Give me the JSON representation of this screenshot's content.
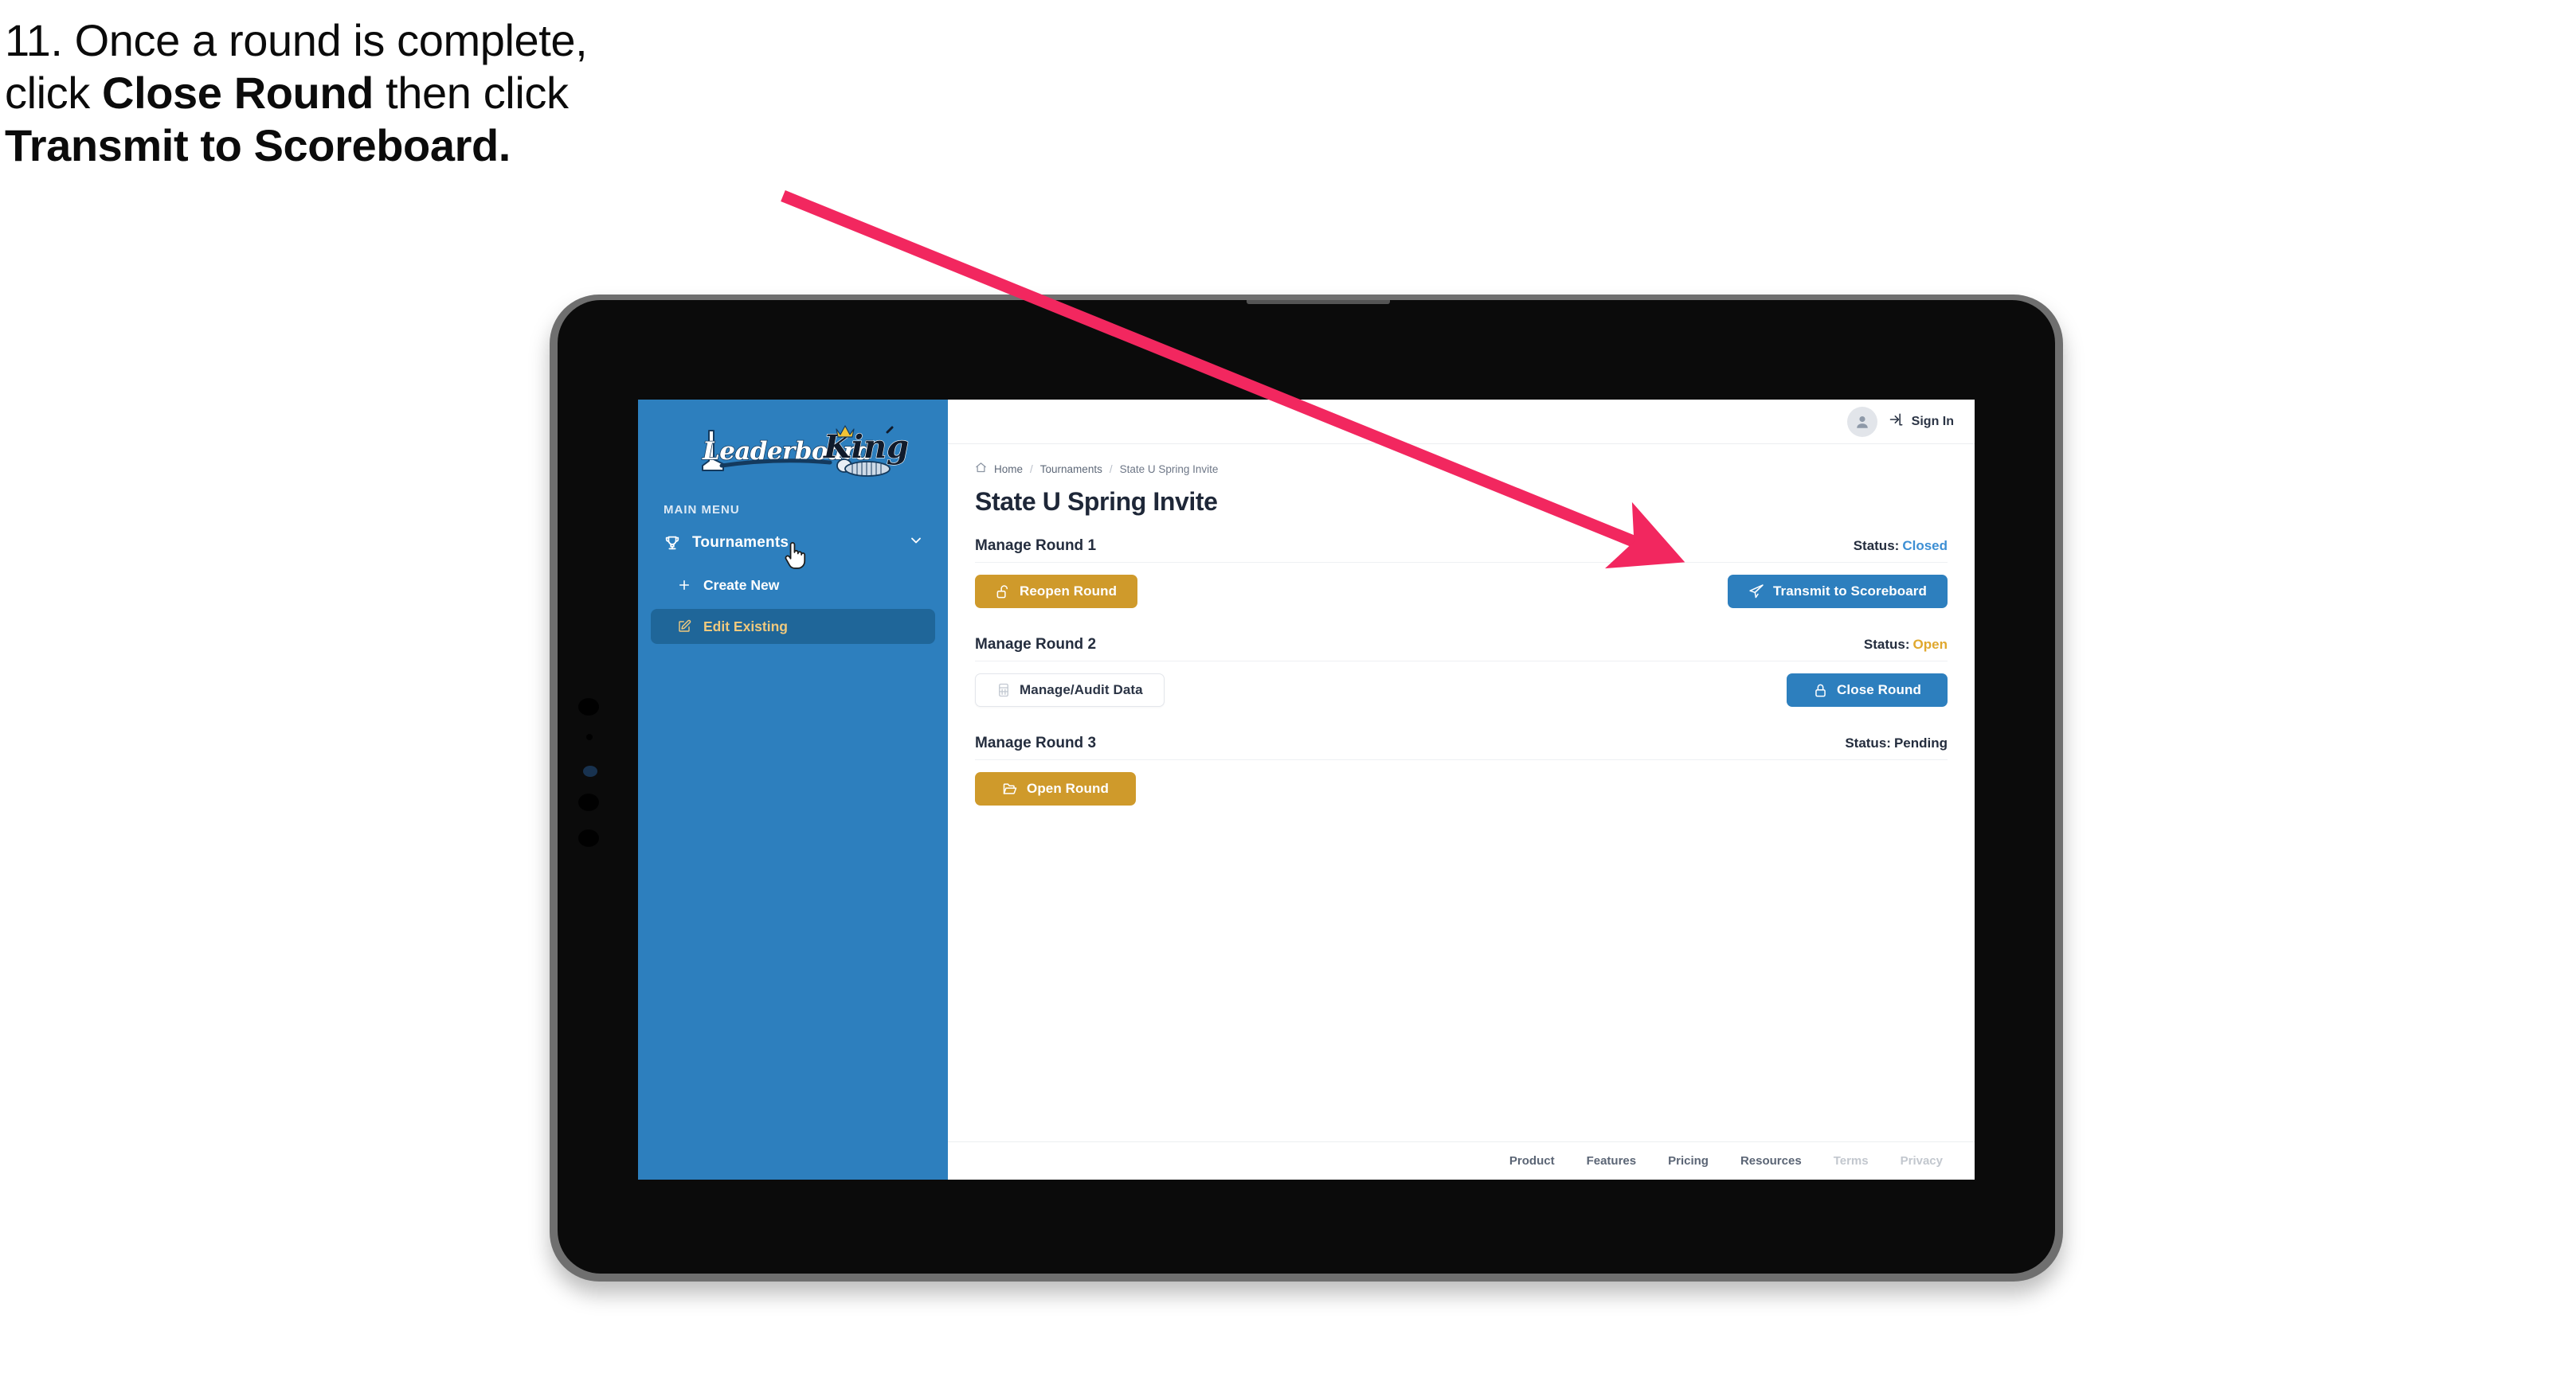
{
  "caption": {
    "line1": "11. Once a round is complete,",
    "line2_pre": "click ",
    "line2_bold": "Close Round",
    "line2_post": " then click",
    "line3_bold": "Transmit to Scoreboard."
  },
  "annotation": {
    "arrow_color": "#f2275f"
  },
  "app": {
    "sidebar": {
      "logo_text": "LeaderboardKing",
      "logo_word1": "Leaderboard",
      "logo_word2": "King",
      "section_label": "MAIN MENU",
      "items": [
        {
          "label": "Tournaments",
          "icon": "trophy-icon",
          "chevron": "chevron-down-icon",
          "active": false
        },
        {
          "label": "Create New",
          "icon": "plus-icon",
          "active": false
        },
        {
          "label": "Edit Existing",
          "icon": "edit-pencil-icon",
          "active": true
        }
      ],
      "bg_color": "#2d7fbe",
      "active_bg_color": "#1f6699",
      "active_text_color": "#efc97e"
    },
    "topbar": {
      "avatar_icon": "user-avatar-icon",
      "signin_icon": "sign-in-arrow-icon",
      "signin_label": "Sign In"
    },
    "breadcrumb": {
      "home_icon": "home-icon",
      "items": [
        "Home",
        "Tournaments",
        "State U Spring Invite"
      ],
      "separator": "/"
    },
    "page_title": "State U Spring Invite",
    "rounds": [
      {
        "title": "Manage Round 1",
        "status_label": "Status:",
        "status_value": "Closed",
        "status_class": "status-closed",
        "left_button": {
          "label": "Reopen Round",
          "icon": "unlock-icon",
          "style": "gold"
        },
        "right_button": {
          "label": "Transmit to Scoreboard",
          "icon": "paper-plane-icon",
          "style": "blue"
        }
      },
      {
        "title": "Manage Round 2",
        "status_label": "Status:",
        "status_value": "Open",
        "status_class": "status-open",
        "left_button": {
          "label": "Manage/Audit Data",
          "icon": "calculator-icon",
          "style": "ghost"
        },
        "right_button": {
          "label": "Close Round",
          "icon": "lock-icon",
          "style": "blue"
        }
      },
      {
        "title": "Manage Round 3",
        "status_label": "Status:",
        "status_value": "Pending",
        "status_class": "status-pending",
        "left_button": {
          "label": "Open Round",
          "icon": "open-folder-icon",
          "style": "gold"
        },
        "right_button": null
      }
    ],
    "footer": {
      "links": [
        {
          "label": "Product",
          "muted": false
        },
        {
          "label": "Features",
          "muted": false
        },
        {
          "label": "Pricing",
          "muted": false
        },
        {
          "label": "Resources",
          "muted": false
        },
        {
          "label": "Terms",
          "muted": true
        },
        {
          "label": "Privacy",
          "muted": true
        }
      ]
    },
    "colors": {
      "gold": "#cf9a2b",
      "blue": "#2d7fbe",
      "status_closed": "#3d8fd4",
      "status_open": "#e0a82e",
      "text_dark": "#242d3e"
    }
  }
}
